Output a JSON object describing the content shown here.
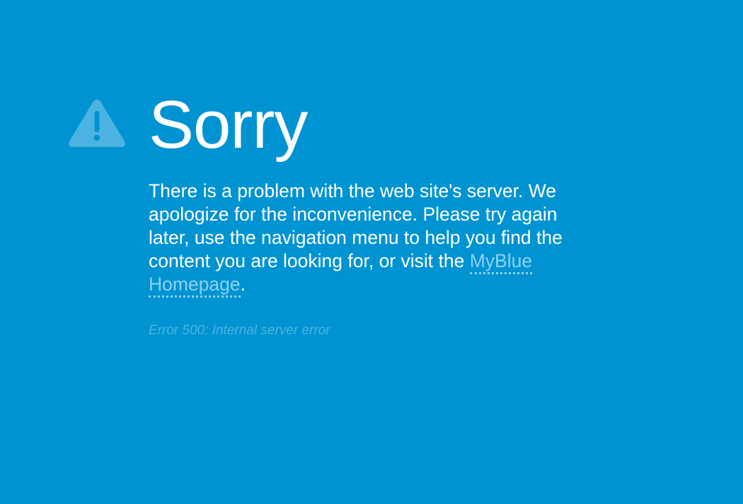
{
  "page": {
    "icon": "warning-triangle-icon",
    "title": "Sorry",
    "message_before_link": "There is a problem with the web site's server. We apologize for the inconvenience. Please try again later, use the navigation menu to help you find the content you are looking for, or visit the ",
    "link_text": "MyBlue Homepage",
    "message_after_link": ".",
    "error_text": "Error 500: Internal server error"
  },
  "colors": {
    "background": "#0093d2",
    "text": "#ffffff",
    "link": "#8fd1f0",
    "error_text": "#4bb3e2",
    "icon": "#4bb3e2"
  }
}
